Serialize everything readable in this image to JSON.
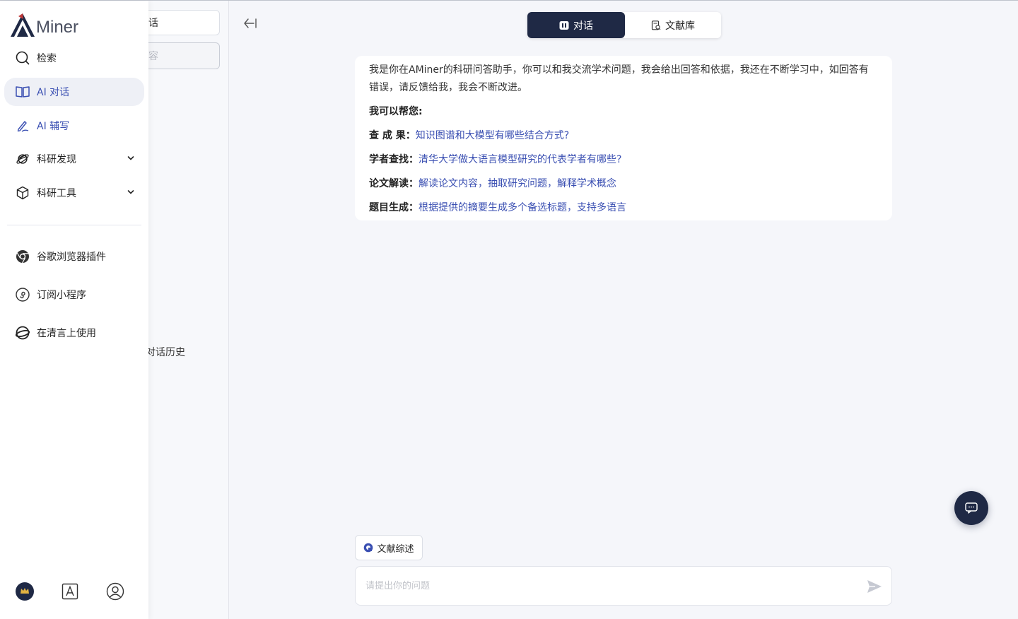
{
  "app": {
    "logo_text": "Miner",
    "brand_color": "#1f2945",
    "accent_color": "#3a4fb2"
  },
  "sidebar": {
    "items": [
      {
        "label": "检索",
        "icon": "search-icon"
      },
      {
        "label": "AI 对话",
        "icon": "book-icon",
        "active": true
      },
      {
        "label": "AI 辅写",
        "icon": "pen-icon"
      },
      {
        "label": "科研发现",
        "icon": "planet-icon",
        "expandable": true
      },
      {
        "label": "科研工具",
        "icon": "cube-icon",
        "expandable": true
      }
    ],
    "links": [
      {
        "label": "谷歌浏览器插件",
        "icon": "chrome-icon"
      },
      {
        "label": "订阅小程序",
        "icon": "mini-program-icon"
      },
      {
        "label": "在清言上使用",
        "icon": "qingyan-icon"
      }
    ],
    "bottom_icons": [
      "vip-crown-icon",
      "font-a-icon",
      "user-icon"
    ]
  },
  "column2": {
    "box1_text": "话",
    "box2_text": "容",
    "history_text": "对话历史"
  },
  "main": {
    "tabs": [
      {
        "label": "对话",
        "icon": "chat-icon",
        "active": true
      },
      {
        "label": "文献库",
        "icon": "library-icon",
        "active": false
      }
    ],
    "welcome": {
      "intro": "我是你在AMiner的科研问答助手，你可以和我交流学术问题，我会给出回答和依据，我还在不断学习中，如回答有错误，请反馈给我，我会不断改进。",
      "sub": "我可以帮您:",
      "rows": [
        {
          "key": "查 成 果：",
          "value": "知识图谱和大模型有哪些结合方式?"
        },
        {
          "key": "学者查找：",
          "value": "清华大学做大语言模型研究的代表学者有哪些?"
        },
        {
          "key": "论文解读：",
          "value": "解读论文内容，抽取研究问题，解释学术概念"
        },
        {
          "key": "题目生成：",
          "value": "根据提供的摘要生成多个备选标题，支持多语言"
        }
      ]
    },
    "review_chip": "文献综述",
    "input": {
      "placeholder": "请提出你的问题",
      "value": ""
    }
  }
}
